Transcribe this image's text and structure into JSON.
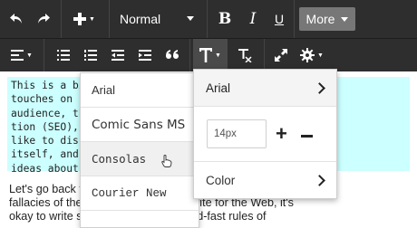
{
  "toolbar": {
    "format_select": "Normal",
    "bold": "B",
    "italic": "I",
    "underline": "U",
    "more_label": "More"
  },
  "content": {
    "code_lines": [
      "This is a bi              that answer",
      "touches on s              ionale,",
      "audience, th              optimiza-",
      "tion (SEO),               hat I'd",
      "like to disc              writing",
      "itself, and               pt certain",
      "ideas about"
    ],
    "paragraph_lines": [
      "Let's go back t                                      e greatest",
      "fallacies of the                 u're learning how to write for the Web, it's",
      "okay to write s                  e some of the hard-and-fast rules of"
    ]
  },
  "font_menu": {
    "items": [
      "Arial",
      "Comic Sans MS",
      "Consolas",
      "Courier New"
    ],
    "hovered_index": 2
  },
  "text_panel": {
    "font_label": "Arial",
    "size_value": "14px",
    "color_label": "Color"
  }
}
